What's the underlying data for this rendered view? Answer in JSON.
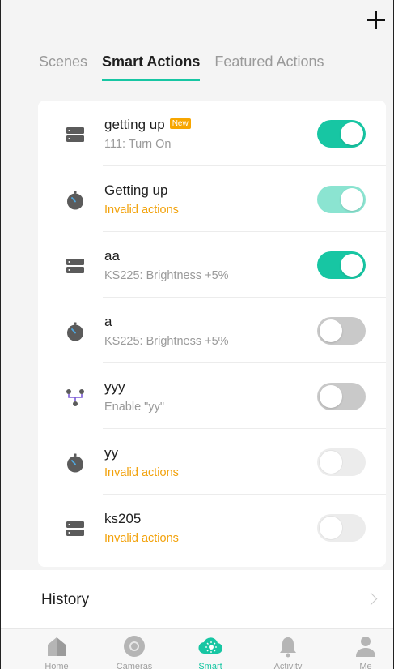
{
  "header": {
    "add_icon": "plus-icon"
  },
  "tabs": [
    {
      "label": "Scenes",
      "active": false
    },
    {
      "label": "Smart Actions",
      "active": true
    },
    {
      "label": "Featured Actions",
      "active": false
    }
  ],
  "actions": [
    {
      "title": "getting up",
      "badge": "New",
      "subtitle": "111: Turn On",
      "subtitle_type": "normal",
      "icon": "device-icon",
      "toggle": "on"
    },
    {
      "title": "Getting up",
      "badge": "",
      "subtitle": "Invalid actions",
      "subtitle_type": "warning",
      "icon": "timer-icon",
      "toggle": "on-disabled"
    },
    {
      "title": "aa",
      "badge": "",
      "subtitle": "KS225: Brightness +5%",
      "subtitle_type": "normal",
      "icon": "device-icon",
      "toggle": "on"
    },
    {
      "title": "a",
      "badge": "",
      "subtitle": "KS225: Brightness +5%",
      "subtitle_type": "normal",
      "icon": "timer-icon",
      "toggle": "off"
    },
    {
      "title": "yyy",
      "badge": "",
      "subtitle": "Enable \"yy\"",
      "subtitle_type": "normal",
      "icon": "branch-icon",
      "toggle": "off"
    },
    {
      "title": "yy",
      "badge": "",
      "subtitle": "Invalid actions",
      "subtitle_type": "warning",
      "icon": "timer-icon",
      "toggle": "off-disabled"
    },
    {
      "title": "ks205",
      "badge": "",
      "subtitle": "Invalid actions",
      "subtitle_type": "warning",
      "icon": "device-icon",
      "toggle": "off-disabled"
    }
  ],
  "history": {
    "label": "History",
    "chevron_icon": "chevron-right-icon"
  },
  "bottom_nav": [
    {
      "label": "Home",
      "icon": "home-icon",
      "active": false
    },
    {
      "label": "Cameras",
      "icon": "camera-icon",
      "active": false
    },
    {
      "label": "Smart",
      "icon": "smart-cloud-icon",
      "active": true
    },
    {
      "label": "Activity",
      "icon": "bell-icon",
      "active": false
    },
    {
      "label": "Me",
      "icon": "person-icon",
      "active": false
    }
  ],
  "colors": {
    "accent": "#17c6a3",
    "warning": "#f2a20c",
    "badge": "#f7a600"
  }
}
